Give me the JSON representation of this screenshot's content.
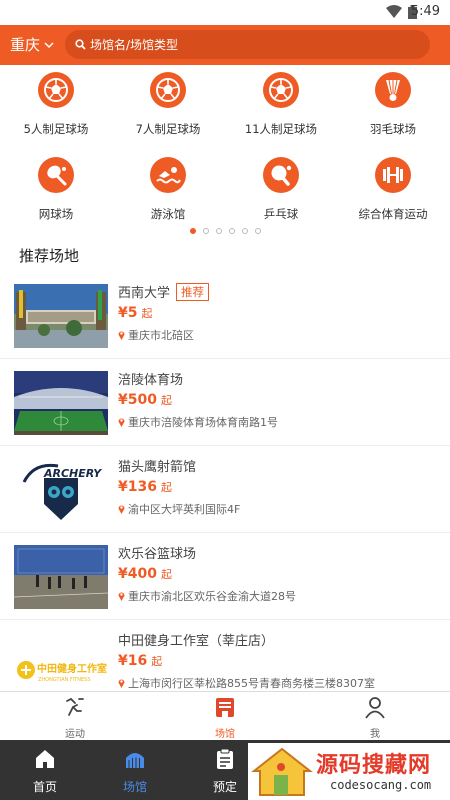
{
  "status_bar": {
    "time": "5:49"
  },
  "header": {
    "city": "重庆",
    "search_placeholder": "场馆名/场馆类型"
  },
  "categories": [
    {
      "label": "5人制足球场",
      "icon": "soccer-ball-icon"
    },
    {
      "label": "7人制足球场",
      "icon": "soccer-ball-icon"
    },
    {
      "label": "11人制足球场",
      "icon": "soccer-ball-icon"
    },
    {
      "label": "羽毛球场",
      "icon": "shuttlecock-icon"
    },
    {
      "label": "网球场",
      "icon": "tennis-racket-icon"
    },
    {
      "label": "游泳馆",
      "icon": "swimmer-icon"
    },
    {
      "label": "乒乓球",
      "icon": "ping-pong-paddle-icon"
    },
    {
      "label": "综合体育运动",
      "icon": "dumbbell-icon"
    }
  ],
  "pagination": {
    "total": 6,
    "active": 1
  },
  "section_title": "推荐场地",
  "venues": [
    {
      "name": "西南大学",
      "tag": "推荐",
      "price": "¥5",
      "price_suffix": "起",
      "address": "重庆市北碚区"
    },
    {
      "name": "涪陵体育场",
      "tag": "",
      "price": "¥500",
      "price_suffix": "起",
      "address": "重庆市涪陵体育场体育南路1号"
    },
    {
      "name": "猫头鹰射箭馆",
      "tag": "",
      "price": "¥136",
      "price_suffix": "起",
      "address": "渝中区大坪英利国际4F",
      "logo_text": "ARCHERY"
    },
    {
      "name": "欢乐谷篮球场",
      "tag": "",
      "price": "¥400",
      "price_suffix": "起",
      "address": "重庆市渝北区欢乐谷金渝大道28号"
    },
    {
      "name": "中田健身工作室（莘庄店）",
      "tag": "",
      "price": "¥16",
      "price_suffix": "起",
      "address": "上海市闵行区莘松路855号青春商务楼三楼8307室",
      "logo_text": "中田健身工作室",
      "logo_subtext": "ZHONGTIAN FITNESS"
    }
  ],
  "sub_tabs": [
    {
      "label": "运动",
      "icon": "runner-icon"
    },
    {
      "label": "场馆",
      "icon": "building-icon",
      "active": true
    },
    {
      "label": "我",
      "icon": "person-icon"
    }
  ],
  "main_tabs": [
    {
      "label": "首页",
      "icon": "home-icon"
    },
    {
      "label": "场馆",
      "icon": "stadium-icon",
      "active": true
    },
    {
      "label": "预定",
      "icon": "clipboard-icon"
    }
  ],
  "watermark": {
    "text": "源码搜藏网",
    "url": "codesocang.com"
  },
  "colors": {
    "accent": "#ef5b24",
    "tab_active": "#4a8ae8",
    "tabbar_bg": "#333333"
  }
}
